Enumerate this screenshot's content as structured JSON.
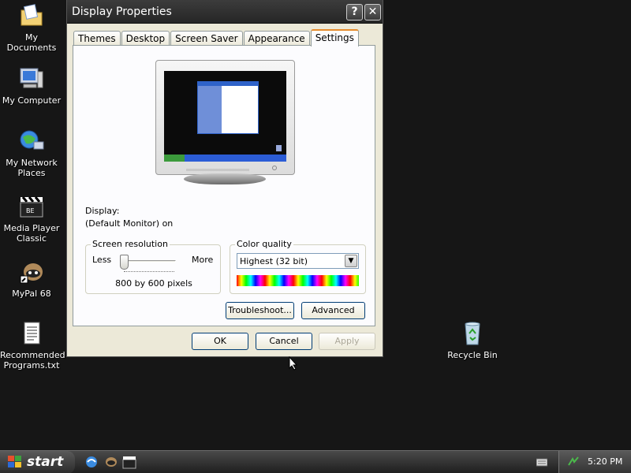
{
  "desktop": {
    "icons": [
      {
        "label": "My Documents"
      },
      {
        "label": "My Computer"
      },
      {
        "label": "My Network Places"
      },
      {
        "label": "Media Player Classic"
      },
      {
        "label": "MyPal 68"
      },
      {
        "label": "Recommended Programs.txt"
      },
      {
        "label": "Recycle Bin"
      }
    ]
  },
  "window": {
    "title": "Display Properties",
    "help_glyph": "?",
    "close_glyph": "✕",
    "tabs": [
      {
        "label": "Themes"
      },
      {
        "label": "Desktop"
      },
      {
        "label": "Screen Saver"
      },
      {
        "label": "Appearance"
      },
      {
        "label": "Settings",
        "active": true
      }
    ],
    "settings": {
      "display_label": "Display:",
      "display_value": "(Default Monitor) on",
      "resolution": {
        "title": "Screen resolution",
        "less": "Less",
        "more": "More",
        "value_text": "800 by 600 pixels",
        "slider_position": 0
      },
      "color_quality": {
        "title": "Color quality",
        "selected": "Highest (32 bit)"
      },
      "troubleshoot_label": "Troubleshoot...",
      "advanced_label": "Advanced"
    },
    "ok_label": "OK",
    "cancel_label": "Cancel",
    "apply_label": "Apply"
  },
  "taskbar": {
    "start_label": "start",
    "clock": "5:20 PM"
  },
  "colors": {
    "desktop_bg": "#161616",
    "dialog_bg": "#ece9d8",
    "tab_active_accent": "#e68b2c"
  }
}
